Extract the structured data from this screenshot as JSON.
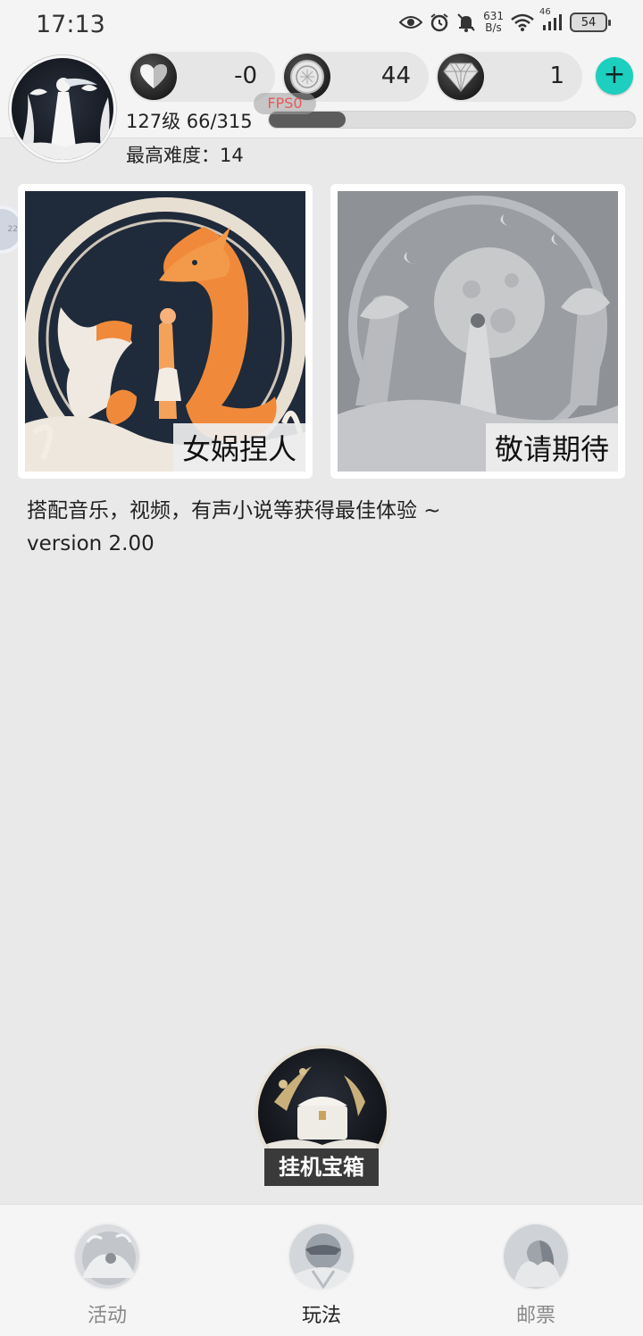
{
  "status_bar": {
    "time": "17:13",
    "speed_value": "631",
    "speed_unit": "B/s",
    "network": "46",
    "battery": "54",
    "icons": [
      "eye-icon",
      "alarm-icon",
      "bell-muted-icon",
      "wifi-icon",
      "signal-icon",
      "battery-icon"
    ]
  },
  "header": {
    "hearts": "-0",
    "coins": "44",
    "diamonds": "1",
    "level_text": "127级 66/315",
    "exp_progress": 0.21,
    "fps_label": "FPS0",
    "max_difficulty": "最高难度：14",
    "side_tab_text": "22",
    "plus_label": "+"
  },
  "cards": [
    {
      "label": "女娲捏人"
    },
    {
      "label": "敬请期待"
    }
  ],
  "tip": "搭配音乐，视频，有声小说等获得最佳体验 ~",
  "version": "version 2.00",
  "chest": {
    "label": "挂机宝箱"
  },
  "nav": {
    "items": [
      {
        "label": "活动",
        "active": false
      },
      {
        "label": "玩法",
        "active": true
      },
      {
        "label": "邮票",
        "active": false
      }
    ]
  },
  "colors": {
    "accent": "#1ccfbe",
    "background": "#e9e9e9",
    "fps_text": "#e65a5a"
  }
}
